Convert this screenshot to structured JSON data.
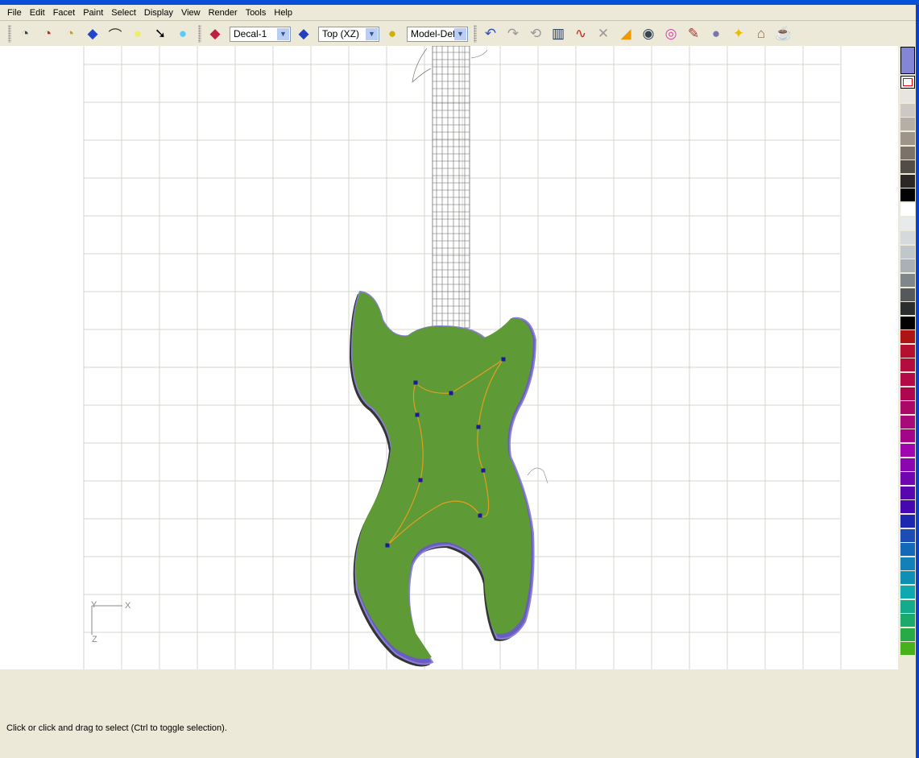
{
  "menu": [
    "File",
    "Edit",
    "Facet",
    "Paint",
    "Select",
    "Display",
    "View",
    "Render",
    "Tools",
    "Help"
  ],
  "toolbar": {
    "decal_select": "Decal-1",
    "view_select": "Top (XZ)",
    "model_select": "Model-Defa",
    "icons_left": [
      "view-eye-icon",
      "view-eye-red-icon",
      "view-eye-yellow-icon",
      "grid-plane-icon",
      "curve-view-icon",
      "light-bulb-icon",
      "cursor-light-icon",
      "circle-icon"
    ],
    "icons_right": [
      "undo-icon",
      "redo-icon",
      "repeat-icon",
      "histogram-icon",
      "curve-edit-icon",
      "curve-delete-icon",
      "brush-fill-icon",
      "eye-icon",
      "color-wheel-icon",
      "brushes-icon",
      "sphere-icon",
      "spotlight-icon",
      "room-icon",
      "teapot-icon"
    ]
  },
  "axes": {
    "y": "Y",
    "x": "X",
    "z": "Z"
  },
  "palette": {
    "current_color": "#8585d8",
    "colors": [
      "#e8e5e0",
      "#cdc8c3",
      "#b7aea5",
      "#9e948a",
      "#7c726a",
      "#524c47",
      "#2b2725",
      "#030303",
      "#ffffff",
      "#e8eaec",
      "#d5d9dc",
      "#c0c6ca",
      "#aab1b6",
      "#80878b",
      "#55595c",
      "#2b2d2e",
      "#020202",
      "#ae1414",
      "#b51030",
      "#b50c40",
      "#b50a48",
      "#b0064f",
      "#ac0867",
      "#a80a77",
      "#a40488",
      "#a006b0",
      "#8a06b0",
      "#7006b0",
      "#5a06b0",
      "#4606b0",
      "#1c28b0",
      "#1c4cb4",
      "#1468b8",
      "#1480b8",
      "#0e90b6",
      "#0ea8b0",
      "#14aa8c",
      "#1aaa6e",
      "#28aa46",
      "#48b01a"
    ]
  },
  "status": "Click or click and drag to select (Ctrl to toggle selection)."
}
